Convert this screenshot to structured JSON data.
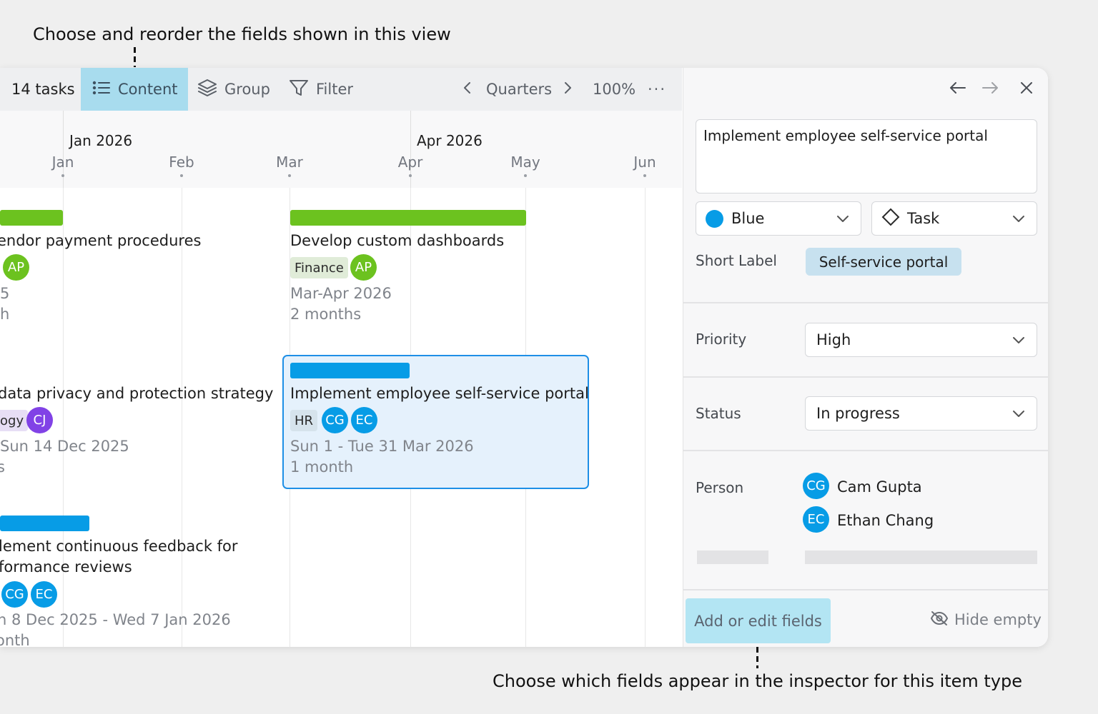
{
  "callouts": {
    "top": "Choose and reorder the fields shown in this view",
    "bottom": "Choose which fields appear in the inspector for this item type"
  },
  "toolbar": {
    "task_count": "14 tasks",
    "content": "Content",
    "group": "Group",
    "filter": "Filter",
    "period": "Quarters",
    "zoom": "100%",
    "more": "···"
  },
  "timeline": {
    "quarters": [
      "Jan 2026",
      "Apr 2026"
    ],
    "months": [
      "Jan",
      "Feb",
      "Mar",
      "Apr",
      "May",
      "Jun"
    ]
  },
  "tasks": [
    {
      "title": "endor payment procedures",
      "color": "#6cc21f",
      "assignees": [
        "AP"
      ],
      "dates": "5",
      "duration": "h"
    },
    {
      "title": "Develop custom dashboards",
      "color": "#6cc21f",
      "tag": "Finance",
      "assignees": [
        "AP"
      ],
      "dates": "Mar-Apr 2026",
      "duration": "2 months"
    },
    {
      "title": "data privacy and protection strategy",
      "color": "#079ce6",
      "tag": "ogy",
      "assignees": [
        "CJ"
      ],
      "dates": "Sun 14 Dec 2025",
      "duration": "s"
    },
    {
      "title": "Implement employee self-service portal",
      "color": "#079ce6",
      "tag": "HR",
      "assignees": [
        "CG",
        "EC"
      ],
      "dates": "Sun 1 - Tue 31 Mar 2026",
      "duration": "1 month",
      "selected": true
    },
    {
      "title_line1": "lement continuous feedback for",
      "title_line2": "formance reviews",
      "color": "#079ce6",
      "assignees": [
        "CG",
        "EC"
      ],
      "dates": "n 8 Dec 2025 - Wed 7 Jan 2026",
      "duration": "onth"
    }
  ],
  "inspector": {
    "title": "Implement employee self-service portal",
    "color_value": "Blue",
    "color_hex": "#079ce6",
    "type_value": "Task",
    "short_label_label": "Short Label",
    "short_label_value": "Self-service portal",
    "priority_label": "Priority",
    "priority_value": "High",
    "status_label": "Status",
    "status_value": "In progress",
    "person_label": "Person",
    "persons": [
      {
        "initials": "CG",
        "name": "Cam Gupta"
      },
      {
        "initials": "EC",
        "name": "Ethan Chang"
      }
    ],
    "add_fields": "Add or edit fields",
    "hide_empty": "Hide empty"
  }
}
